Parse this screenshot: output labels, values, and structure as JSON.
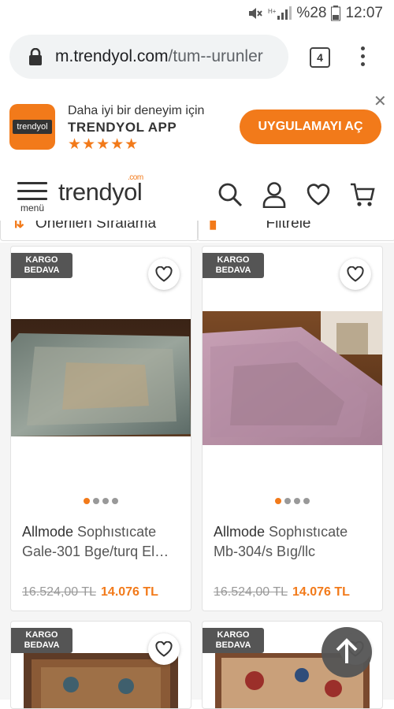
{
  "status_bar": {
    "battery": "%28",
    "time": "12:07"
  },
  "browser": {
    "url_host": "m.trendyol.com",
    "url_path": "/tum--urunler",
    "tab_count": "4"
  },
  "app_banner": {
    "logo_text": "trendyol",
    "line1": "Daha iyi bir deneyim için",
    "line2": "TRENDYOL APP",
    "stars": "★★★★★",
    "open_label": "UYGULAMAYI AÇ",
    "close": "✕"
  },
  "header": {
    "menu_label": "menü",
    "logo": "trendyol",
    "logo_com": ".com"
  },
  "sortbar": {
    "sort_label": "Önerilen Sıralama",
    "filter_label": "Filtrele"
  },
  "products": [
    {
      "badge_line1": "KARGO",
      "badge_line2": "BEDAVA",
      "brand": "Allmode",
      "name": "Sophıstıcate Gale-301 Bge/turq El…",
      "old_price": "16.524,00 TL",
      "new_price": "14.076 TL"
    },
    {
      "badge_line1": "KARGO",
      "badge_line2": "BEDAVA",
      "brand": "Allmode",
      "name": "Sophıstıcate Mb-304/s Bıg/llc",
      "old_price": "16.524,00 TL",
      "new_price": "14.076 TL"
    },
    {
      "badge_line1": "KARGO",
      "badge_line2": "BEDAVA"
    },
    {
      "badge_line1": "KARGO",
      "badge_line2": "BEDAVA"
    }
  ],
  "colors": {
    "brand_orange": "#f27a1a",
    "badge_gray": "#555555"
  },
  "icons": [
    "mute-icon",
    "signal-icon",
    "battery-icon",
    "lock-icon",
    "tabs-icon",
    "menu-icon",
    "hamburger-icon",
    "search-icon",
    "user-icon",
    "heart-icon",
    "cart-icon",
    "arrow-up-icon"
  ]
}
